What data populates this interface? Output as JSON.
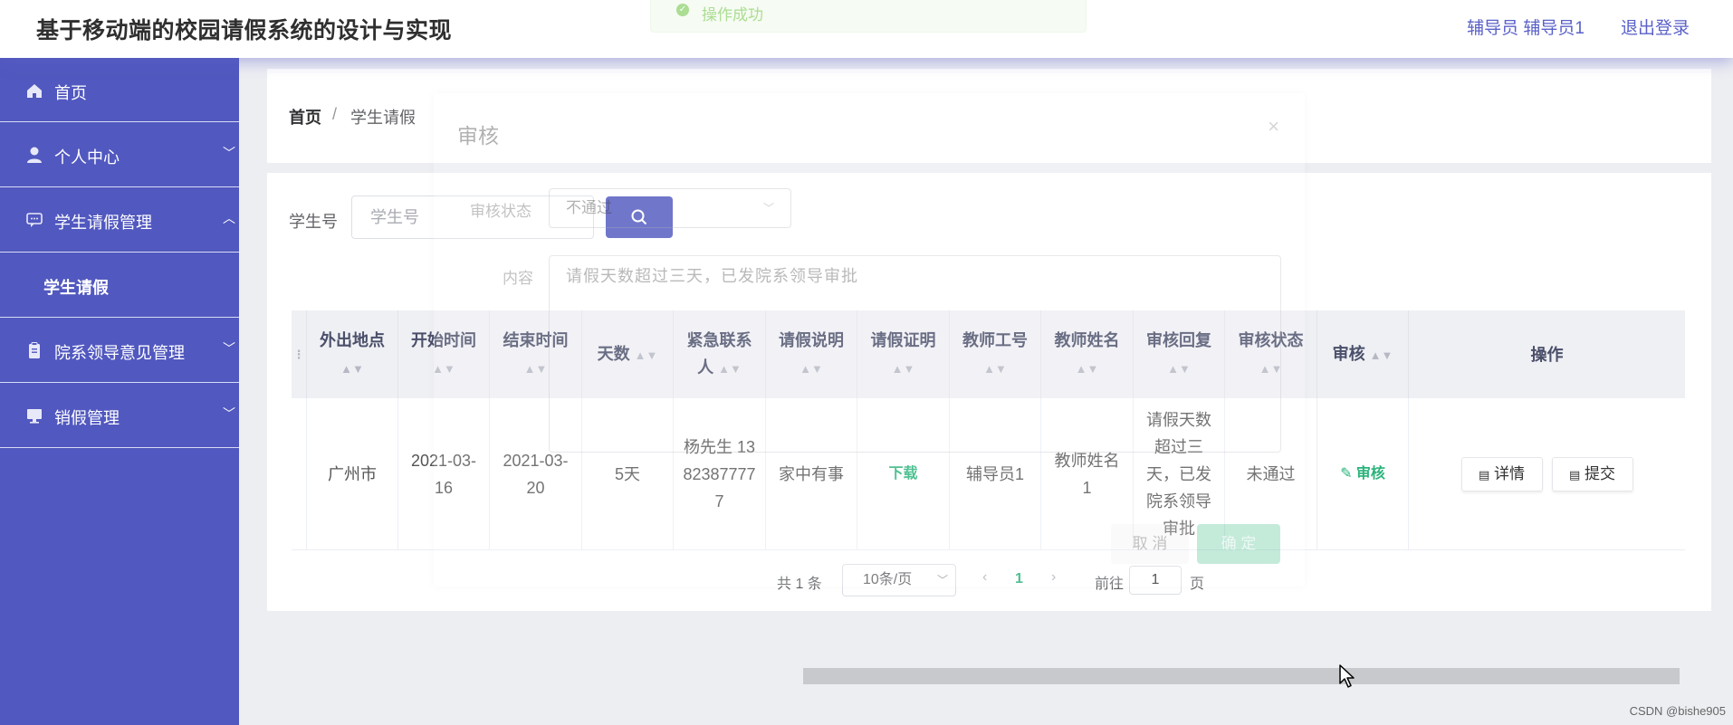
{
  "header": {
    "title": "基于移动端的校园请假系统的设计与实现",
    "user": "辅导员 辅导员1",
    "logout": "退出登录"
  },
  "toast": {
    "message": "操作成功",
    "type": "success"
  },
  "sidebar": {
    "items": [
      {
        "label": "首页",
        "icon": "home-icon"
      },
      {
        "label": "个人中心",
        "icon": "user-icon",
        "expanded": false
      },
      {
        "label": "学生请假管理",
        "icon": "chat-icon",
        "expanded": true,
        "children": [
          {
            "label": "学生请假"
          }
        ]
      },
      {
        "label": "院系领导意见管理",
        "icon": "clipboard-icon",
        "expanded": false
      },
      {
        "label": "销假管理",
        "icon": "monitor-icon",
        "expanded": false
      }
    ],
    "colors": {
      "background": "#5158bf"
    }
  },
  "breadcrumb": {
    "home": "首页",
    "separator": "/",
    "current": "学生请假"
  },
  "search": {
    "label": "学生号",
    "placeholder": "学生号"
  },
  "table": {
    "columns": [
      "外出地点",
      "开始时间",
      "结束时间",
      "天数",
      "紧急联系人",
      "请假说明",
      "请假证明",
      "教师工号",
      "教师姓名",
      "审核回复",
      "审核状态",
      "审核",
      "操作"
    ],
    "rows": [
      {
        "location": "广州市",
        "start": "2021-03-16",
        "end": "2021-03-20",
        "days": "5天",
        "contact": "杨先生 13823877777",
        "reason": "家中有事",
        "proof": "下载",
        "teacher_id": "辅导员1",
        "teacher_name": "教师姓名1",
        "reply": "请假天数超过三天，已发院系领导审批",
        "status": "未通过",
        "review": "审核",
        "details": "详情",
        "submit": "提交"
      }
    ]
  },
  "pagination": {
    "total": "共 1 条",
    "page_size": "10条/页",
    "current": "1",
    "goto": "前往",
    "jump_value": "1",
    "page_unit": "页"
  },
  "modal": {
    "title": "审核",
    "status_label": "审核状态",
    "status_value": "不通过",
    "content_label": "内容",
    "content_value": "请假天数超过三天，已发院系领导审批",
    "cancel": "取 消",
    "confirm": "确 定"
  },
  "watermark": "CSDN @bishe905"
}
